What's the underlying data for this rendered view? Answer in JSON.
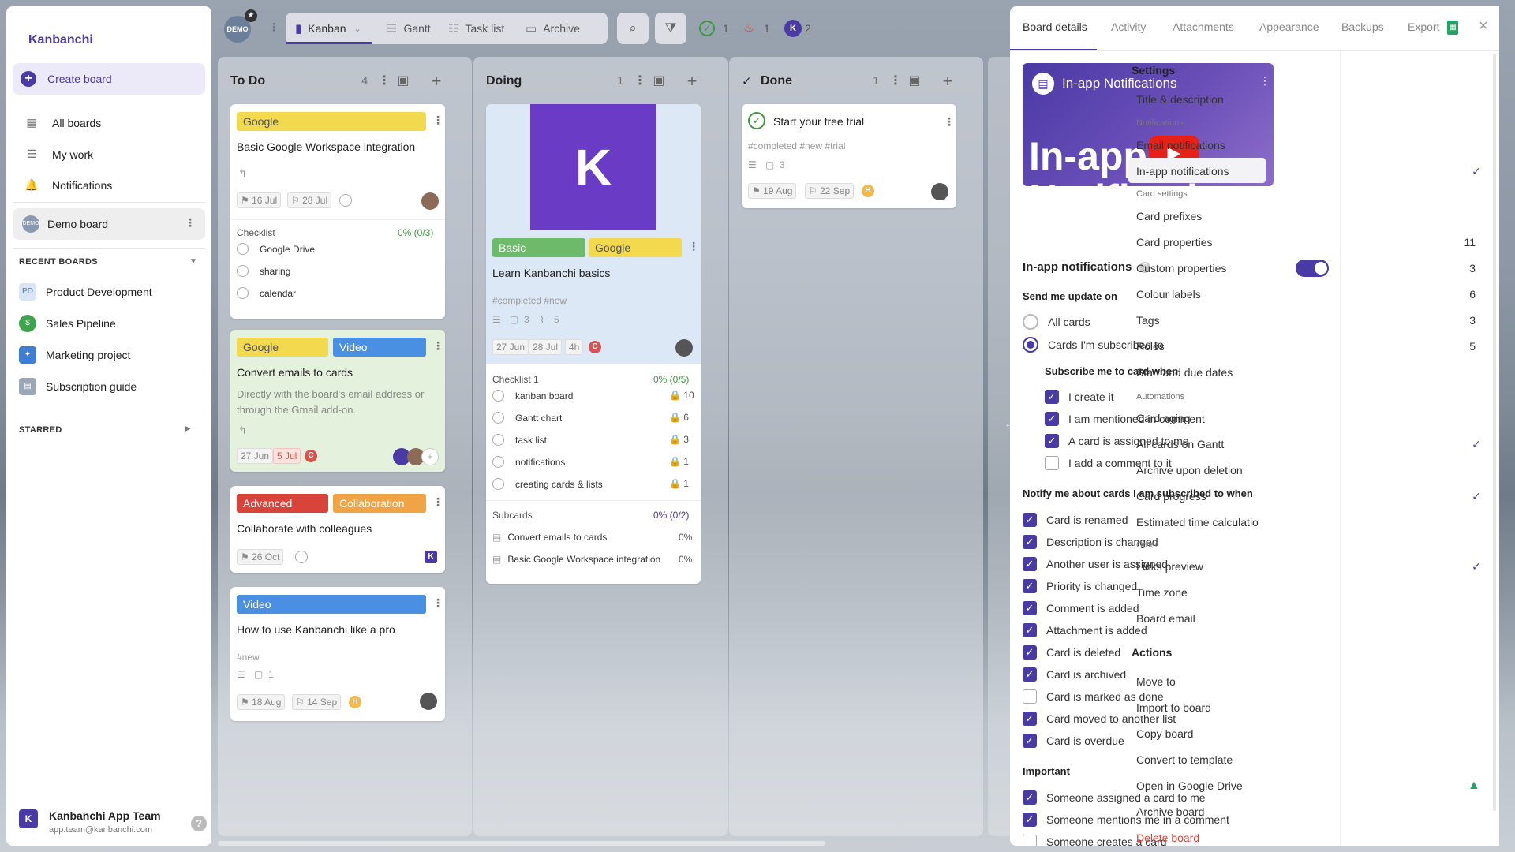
{
  "sidebar": {
    "logo": "Kanbanchi",
    "create": "Create board",
    "nav": [
      {
        "label": "All boards"
      },
      {
        "label": "My work"
      },
      {
        "label": "Notifications"
      }
    ],
    "demo_board": "Demo board",
    "recent_heading": "RECENT BOARDS",
    "recent": [
      {
        "label": "Product Development",
        "abbr": "PD",
        "color": "#d9e6f7"
      },
      {
        "label": "Sales Pipeline",
        "abbr": "$",
        "color": "#3fa34d"
      },
      {
        "label": "Marketing project",
        "abbr": "",
        "color": "#3f7dd1"
      },
      {
        "label": "Subscription guide",
        "abbr": "",
        "color": "#9aa7b6"
      }
    ],
    "starred_heading": "STARRED",
    "user": {
      "name": "Kanbanchi App Team",
      "email": "app.team@kanbanchi.com",
      "initial": "K"
    }
  },
  "toolbar": {
    "board_badge": "DEMO",
    "views": [
      {
        "label": "Kanban"
      },
      {
        "label": "Gantt"
      },
      {
        "label": "Task list"
      },
      {
        "label": "Archive"
      }
    ],
    "counters": [
      {
        "value": "1"
      },
      {
        "value": "1"
      },
      {
        "value": "2"
      }
    ],
    "counter_k": "K"
  },
  "columns": [
    {
      "title": "To Do",
      "count": "4"
    },
    {
      "title": "Doing",
      "count": "1"
    },
    {
      "title": "Done",
      "count": "1"
    }
  ],
  "cards": {
    "c1": {
      "tag": "Google",
      "title": "Basic Google Workspace integration",
      "d1": "16 Jul",
      "d2": "28 Jul",
      "checklist": "Checklist",
      "progress": "0% (0/3)",
      "items": [
        "Google Drive",
        "sharing",
        "calendar"
      ]
    },
    "c2": {
      "tags": [
        "Google",
        "Video"
      ],
      "title": "Convert emails to cards",
      "desc1": "Directly with the board's email address or",
      "desc2": "through the Gmail add-on.",
      "d1": "27 Jun",
      "d2": "5 Jul",
      "mark": "C",
      "more": "+"
    },
    "c3": {
      "tags": [
        "Advanced",
        "Collaboration"
      ],
      "title": "Collaborate with colleagues",
      "d1": "26 Oct",
      "mark": "K"
    },
    "c4": {
      "tag": "Video",
      "title": "How to use Kanbanchi like a pro",
      "hashtags": "#new",
      "comments": "1",
      "d1": "18 Aug",
      "d2": "14 Sep",
      "mark": "H"
    },
    "d1": {
      "logo": "K",
      "tags": [
        "Basic",
        "Google"
      ],
      "title": "Learn Kanbanchi basics",
      "hashtags": "#completed #new",
      "comments": "3",
      "attachments": "5",
      "d1": "27 Jun",
      "d2": "28 Jul",
      "est": "4h",
      "mark": "C",
      "checklist": "Checklist 1",
      "progress": "0% (0/5)",
      "items": [
        {
          "label": "kanban board",
          "n": "10"
        },
        {
          "label": "Gantt chart",
          "n": "6"
        },
        {
          "label": "task list",
          "n": "3"
        },
        {
          "label": "notifications",
          "n": "1"
        },
        {
          "label": "creating cards & lists",
          "n": "1"
        }
      ],
      "subcards": "Subcards",
      "sub_progress": "0% (0/2)",
      "subs": [
        {
          "label": "Convert emails to cards",
          "p": "0%"
        },
        {
          "label": "Basic Google Workspace integration",
          "p": "0%"
        }
      ]
    },
    "e1": {
      "title": "Start your free trial",
      "hashtags": "#completed #new #trial",
      "comments": "3",
      "d1": "19 Aug",
      "d2": "22 Sep",
      "mark": "H"
    }
  },
  "panel": {
    "tabs": [
      "Board details",
      "Activity",
      "Attachments",
      "Appearance",
      "Backups",
      "Export"
    ],
    "video_title": "In-app Notifications",
    "video_big1": "In-app",
    "video_big2": "Notifications",
    "toggle_label": "In-app notifications",
    "send_label": "Send me update on",
    "radios": [
      "All cards",
      "Cards I'm subscribed to"
    ],
    "subscribe_label": "Subscribe me to card when",
    "subscribe": [
      {
        "label": "I create it",
        "on": true
      },
      {
        "label": "I am mentioned in comment",
        "on": true
      },
      {
        "label": "A card is assigned to me",
        "on": true
      },
      {
        "label": "I add a comment to it",
        "on": false
      }
    ],
    "notify_label": "Notify me about cards I am subscribed to when",
    "notify": [
      {
        "label": "Card is renamed",
        "on": true
      },
      {
        "label": "Description is changed",
        "on": true
      },
      {
        "label": "Another user is assigned",
        "on": true
      },
      {
        "label": "Priority is changed",
        "on": true
      },
      {
        "label": "Comment is added",
        "on": true
      },
      {
        "label": "Attachment is added",
        "on": true
      },
      {
        "label": "Card is deleted",
        "on": true
      },
      {
        "label": "Card is archived",
        "on": true
      },
      {
        "label": "Card is marked as done",
        "on": false
      },
      {
        "label": "Card moved to another list",
        "on": true
      },
      {
        "label": "Card is overdue",
        "on": true
      }
    ],
    "important_label": "Important",
    "important": [
      {
        "label": "Someone assigned a card to me",
        "on": true
      },
      {
        "label": "Someone mentions me in a comment",
        "on": true
      },
      {
        "label": "Someone creates a card",
        "on": false
      }
    ]
  },
  "settings": {
    "heading": "Settings",
    "title_desc": "Title & description",
    "notif_head": "Notifications",
    "email_notif": "Email notifications",
    "inapp_notif": "In-app notifications",
    "card_head": "Card settings",
    "card_items": [
      {
        "label": "Card prefixes",
        "n": ""
      },
      {
        "label": "Card properties",
        "n": "11"
      },
      {
        "label": "Custom properties",
        "n": "3"
      },
      {
        "label": "Colour labels",
        "n": "6"
      },
      {
        "label": "Tags",
        "n": "3"
      },
      {
        "label": "Roles",
        "n": "5"
      },
      {
        "label": "Start and due dates",
        "n": ""
      }
    ],
    "auto_head": "Automations",
    "auto_items": [
      "Card aging",
      "All cards on Gantt",
      "Archive upon deletion",
      "Card progress",
      "Estimated time calculatio"
    ],
    "other_head": "Other",
    "other_items": [
      "Links preview",
      "Time zone",
      "Board email"
    ],
    "actions_head": "Actions",
    "actions": [
      "Move to",
      "Import to board",
      "Copy board",
      "Convert to template",
      "Open in Google Drive",
      "Archive board",
      "Delete board"
    ]
  }
}
